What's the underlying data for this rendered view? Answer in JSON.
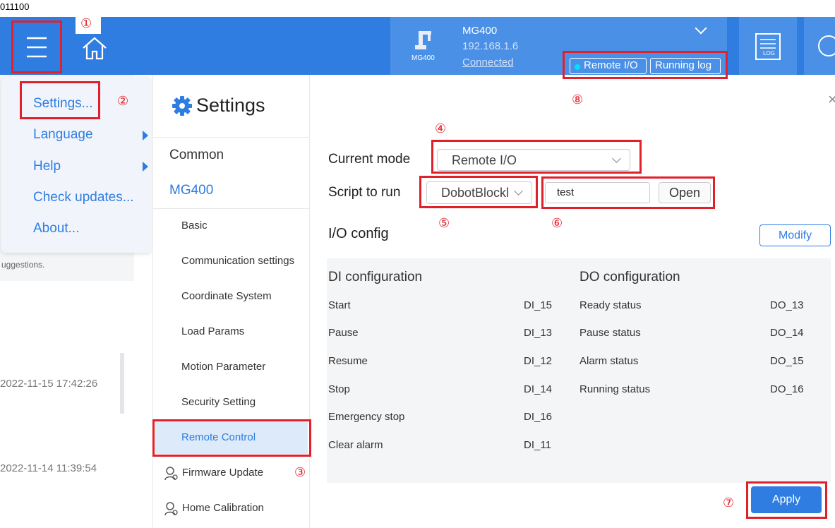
{
  "window": {
    "title_fragment": "011100"
  },
  "annotations": [
    "①",
    "②",
    "③",
    "④",
    "⑤",
    "⑥",
    "⑦",
    "⑧"
  ],
  "topbar": {
    "device_name": "MG400",
    "device_icon_label": "MG400",
    "ip": "192.168.1.6",
    "status": "Connected",
    "remote_io_badge": "Remote I/O",
    "running_log_button": "Running log",
    "log_icon_label": "LOG",
    "status_dot_color": "#00e0ff"
  },
  "menu": {
    "items": [
      {
        "label": "Settings..."
      },
      {
        "label": "Language"
      },
      {
        "label": "Help"
      },
      {
        "label": "Check updates..."
      },
      {
        "label": "About..."
      }
    ]
  },
  "ghost": {
    "text1": "uggestions.",
    "date1": "2022-11-15 17:42:26",
    "date2": "2022-11-14 11:39:54"
  },
  "settings_nav": {
    "title": "Settings",
    "common": "Common",
    "device": "MG400",
    "items": [
      "Basic",
      "Communication settings",
      "Coordinate System",
      "Load Params",
      "Motion Parameter",
      "Security Setting",
      "Remote Control"
    ],
    "firmware_update": "Firmware Update",
    "home_calibration": "Home Calibration"
  },
  "main": {
    "close_glyph": "×",
    "current_mode_label": "Current mode",
    "current_mode_value": "Remote I/O",
    "script_label": "Script to run",
    "script_value": "DobotBlockly",
    "script_file": "test",
    "open_button": "Open",
    "io_title": "I/O config",
    "modify_button": "Modify",
    "di_header": "DI configuration",
    "do_header": "DO configuration",
    "di": [
      {
        "name": "Start",
        "port": "DI_15"
      },
      {
        "name": "Pause",
        "port": "DI_13"
      },
      {
        "name": "Resume",
        "port": "DI_12"
      },
      {
        "name": "Stop",
        "port": "DI_14"
      },
      {
        "name": "Emergency stop",
        "port": "DI_16"
      },
      {
        "name": "Clear alarm",
        "port": "DI_11"
      }
    ],
    "do": [
      {
        "name": "Ready status",
        "port": "DO_13"
      },
      {
        "name": "Pause status",
        "port": "DO_14"
      },
      {
        "name": "Alarm status",
        "port": "DO_15"
      },
      {
        "name": "Running status",
        "port": "DO_16"
      }
    ],
    "apply_button": "Apply"
  },
  "colors": {
    "primary": "#2f7de1",
    "annotation": "#e0202a",
    "selected_nav": "#dceaf9"
  }
}
